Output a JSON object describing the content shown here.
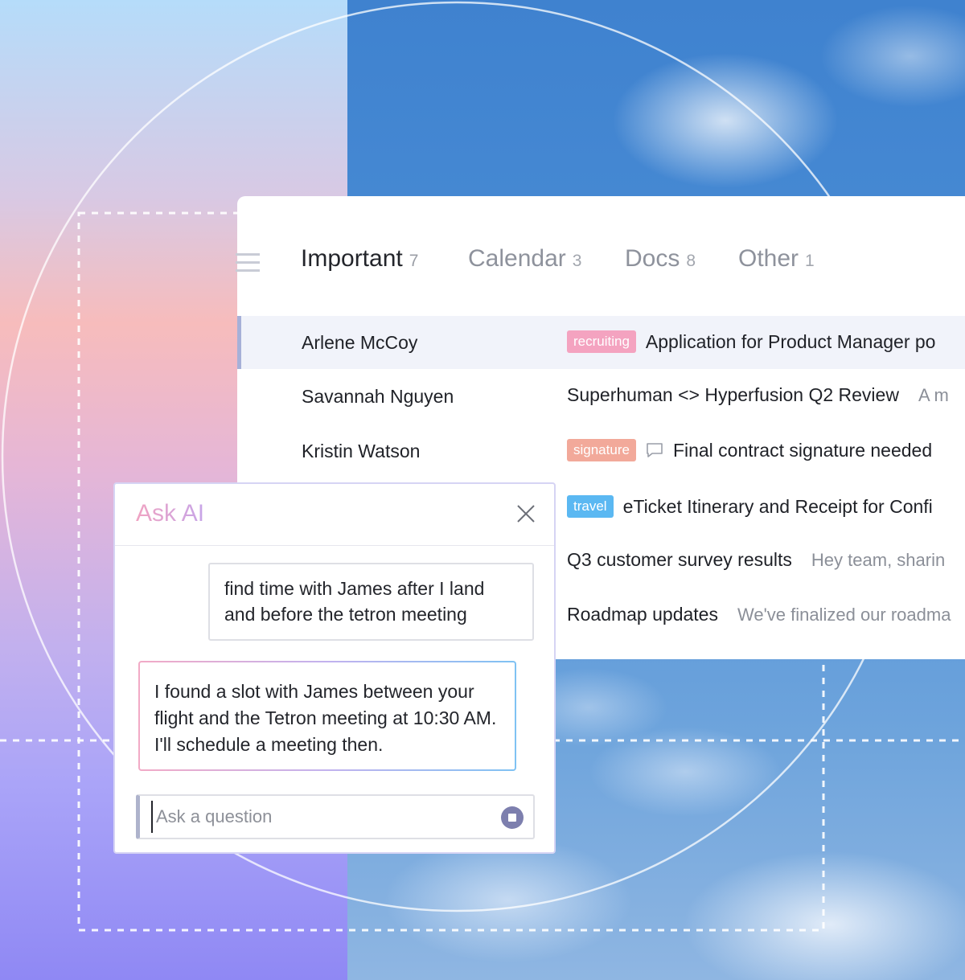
{
  "tabs": [
    {
      "label": "Important",
      "count": "7"
    },
    {
      "label": "Calendar",
      "count": "3"
    },
    {
      "label": "Docs",
      "count": "8"
    },
    {
      "label": "Other",
      "count": "1"
    }
  ],
  "rows": [
    {
      "sender": "Arlene McCoy",
      "tag": "recruiting",
      "subject": "Application for Product Manager po",
      "preview": ""
    },
    {
      "sender": "Savannah Nguyen",
      "tag": "",
      "subject": "Superhuman <> Hyperfusion Q2 Review",
      "preview": "A m"
    },
    {
      "sender": "Kristin Watson",
      "tag": "signature",
      "subject": "Final contract signature needed",
      "preview": ""
    },
    {
      "sender": "",
      "tag": "travel",
      "subject": "eTicket Itinerary and Receipt for Confi",
      "preview": ""
    },
    {
      "sender": "",
      "tag": "",
      "subject": "Q3 customer survey results",
      "preview": "Hey team, sharin"
    },
    {
      "sender": "",
      "tag": "",
      "subject": "Roadmap updates",
      "preview": "We've finalized our roadma"
    }
  ],
  "ask_ai": {
    "title": "Ask AI",
    "user_message": "find time with James after I land and before the tetron meeting",
    "ai_message": "I found a slot with James between your flight and the Tetron meeting at 10:30 AM.  I'll schedule a meeting then.",
    "input_placeholder": "Ask a question"
  },
  "colors": {
    "tag_recruiting": "#f4a3c0",
    "tag_signature": "#f2a99a",
    "tag_travel": "#5bb8f2"
  }
}
